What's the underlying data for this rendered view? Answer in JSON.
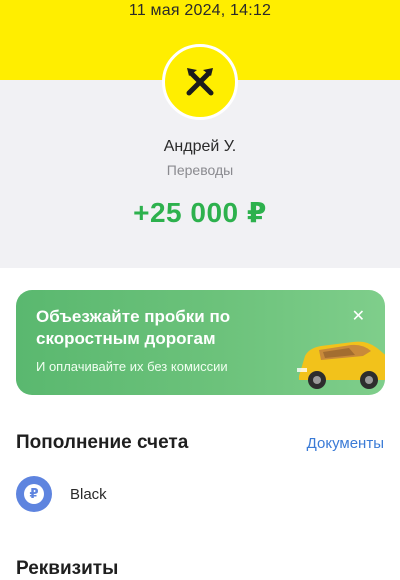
{
  "header": {
    "datetime": "11 мая 2024, 14:12",
    "merchant_name": "Андрей У.",
    "category": "Переводы",
    "amount": "+25 000 ₽"
  },
  "promo": {
    "title": "Объезжайте пробки по скоростным дорогам",
    "subtitle": "И оплачивайте их без комиссии",
    "close_label": "✕"
  },
  "topup": {
    "title": "Пополнение счета",
    "documents_label": "Документы",
    "account_name": "Black",
    "account_icon_glyph": "₽"
  },
  "requisites": {
    "title": "Реквизиты"
  },
  "colors": {
    "brand_yellow": "#ffee00",
    "amount_green": "#2db14d",
    "link_blue": "#3b7bd6",
    "promo_green": "#6cc27b"
  }
}
